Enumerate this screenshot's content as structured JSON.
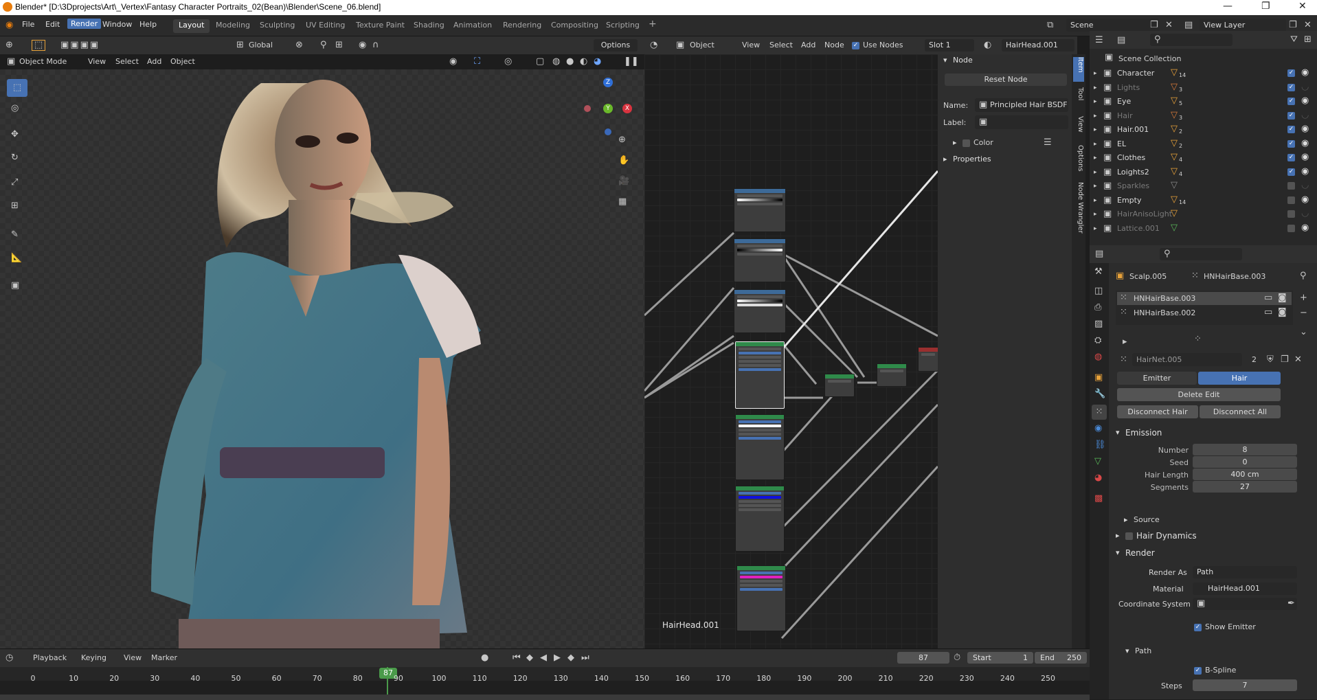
{
  "window": {
    "title": "Blender* [D:\\3Dprojects\\Art\\_Vertex\\Fantasy Character Portraits_02(Bean)\\Blender\\Scene_06.blend]",
    "minimize": "—",
    "maximize": "❐",
    "close": "✕"
  },
  "menu": [
    "File",
    "Edit",
    "Render",
    "Window",
    "Help"
  ],
  "workspaces": [
    "Layout",
    "Modeling",
    "Sculpting",
    "UV Editing",
    "Texture Paint",
    "Shading",
    "Animation",
    "Rendering",
    "Compositing",
    "Scripting"
  ],
  "add_workspace": "+",
  "scene": {
    "name": "Scene",
    "view_layer": "View Layer"
  },
  "viewport": {
    "mode": "Object Mode",
    "menus": [
      "View",
      "Select",
      "Add",
      "Object"
    ],
    "orientation": "Global",
    "options": "Options",
    "gizmo": {
      "z": "Z",
      "y": "Y",
      "x": "X"
    }
  },
  "node_editor": {
    "editor_type": "Object",
    "menus": [
      "View",
      "Select",
      "Add",
      "Node"
    ],
    "use_nodes": "Use Nodes",
    "slot": "Slot 1",
    "material": "HairHead.001",
    "footer_label": "HairHead.001",
    "sidebar": {
      "panel": "Node",
      "reset": "Reset Node",
      "name_label": "Name:",
      "name_value": "Principled Hair BSDF",
      "label_label": "Label:",
      "label_value": "",
      "color": "Color",
      "properties": "Properties",
      "tabs": [
        "Item",
        "Tool",
        "View",
        "Options",
        "Node Wrangler"
      ]
    }
  },
  "outliner": {
    "root": "Scene Collection",
    "items": [
      {
        "name": "Character",
        "badge": "14",
        "checked": true,
        "visible": true,
        "dim": false
      },
      {
        "name": "Lights",
        "badge": "3",
        "checked": true,
        "visible": false,
        "dim": true
      },
      {
        "name": "Eye",
        "badge": "5",
        "checked": true,
        "visible": true,
        "dim": false
      },
      {
        "name": "Hair",
        "badge": "3",
        "checked": true,
        "visible": false,
        "dim": true
      },
      {
        "name": "Hair.001",
        "badge": "2",
        "checked": true,
        "visible": true,
        "dim": false
      },
      {
        "name": "EL",
        "badge": "2",
        "checked": true,
        "visible": true,
        "dim": false
      },
      {
        "name": "Clothes",
        "badge": "4",
        "checked": true,
        "visible": true,
        "dim": false
      },
      {
        "name": "Loights2",
        "badge": "4",
        "checked": true,
        "visible": true,
        "dim": false
      },
      {
        "name": "Sparkles",
        "badge": "",
        "checked": false,
        "visible": false,
        "dim": true
      },
      {
        "name": "Empty",
        "badge": "14",
        "checked": false,
        "visible": true,
        "dim": false
      },
      {
        "name": "HairAnisoLight",
        "badge": "",
        "checked": false,
        "visible": false,
        "dim": true
      },
      {
        "name": "Lattice.001",
        "badge": "",
        "checked": false,
        "visible": true,
        "dim": true
      }
    ]
  },
  "properties": {
    "breadcrumb_object": "Scalp.005",
    "breadcrumb_system": "HNHairBase.003",
    "systems": [
      "HNHairBase.003",
      "HNHairBase.002"
    ],
    "settings_name": "HairNet.005",
    "settings_users": "2",
    "type_tabs": [
      "Emitter",
      "Hair"
    ],
    "delete_edit": "Delete Edit",
    "disconnect_hair": "Disconnect Hair",
    "disconnect_all": "Disconnect All",
    "emission": {
      "title": "Emission",
      "rows": [
        {
          "label": "Number",
          "value": "8"
        },
        {
          "label": "Seed",
          "value": "0"
        },
        {
          "label": "Hair Length",
          "value": "400 cm"
        },
        {
          "label": "Segments",
          "value": "27"
        }
      ]
    },
    "source": "Source",
    "hair_dynamics": "Hair Dynamics",
    "render": {
      "title": "Render",
      "render_as_label": "Render As",
      "render_as": "Path",
      "material_label": "Material",
      "material": "HairHead.001",
      "coord_label": "Coordinate System",
      "show_emitter": "Show Emitter",
      "path_title": "Path",
      "bspline": "B-Spline",
      "steps_label": "Steps",
      "steps": "7"
    }
  },
  "timeline": {
    "menus": [
      "Playback",
      "Keying",
      "View",
      "Marker"
    ],
    "current_frame": "87",
    "start_label": "Start",
    "start": "1",
    "end_label": "End",
    "end": "250",
    "ticks": [
      "0",
      "10",
      "20",
      "30",
      "40",
      "50",
      "60",
      "70",
      "80",
      "90",
      "100",
      "110",
      "120",
      "130",
      "140",
      "150",
      "160",
      "170",
      "180",
      "190",
      "200",
      "210",
      "220",
      "230",
      "240",
      "250"
    ]
  }
}
